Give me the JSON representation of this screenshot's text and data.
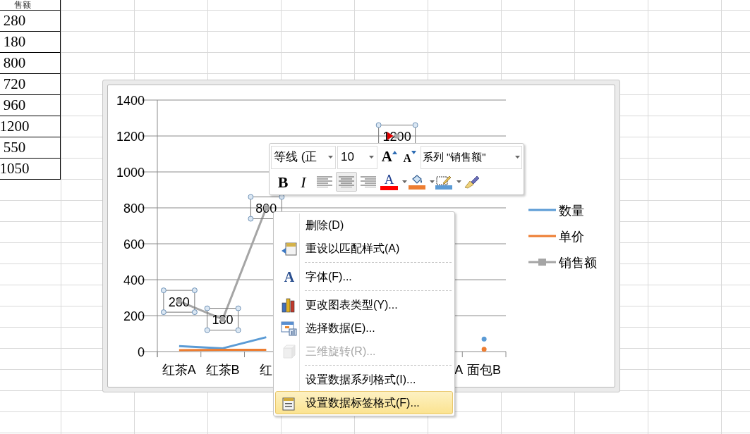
{
  "sheet": {
    "header": "售额",
    "cells": [
      "280",
      "180",
      "800",
      "720",
      "960",
      "1200",
      "550",
      "1050"
    ]
  },
  "chart": {
    "cut_axis_label": "A",
    "chart_data": {
      "type": "line",
      "categories": [
        "红茶A",
        "红茶B",
        "红",
        null,
        null,
        null,
        null,
        "面包B"
      ],
      "ylim": [
        0,
        1400
      ],
      "yticks": [
        0,
        200,
        400,
        600,
        800,
        1000,
        1200,
        1400
      ],
      "grid": true,
      "legend": "right",
      "series": [
        {
          "name": "数量",
          "color": "#5b9bd5",
          "values": [
            30,
            18,
            80,
            null,
            null,
            null,
            null,
            70
          ]
        },
        {
          "name": "单价",
          "color": "#ed7d31",
          "values": [
            8,
            10,
            10,
            null,
            null,
            null,
            null,
            13
          ]
        },
        {
          "name": "销售额",
          "color": "#a5a5a5",
          "marker": "square",
          "values": [
            280,
            180,
            800,
            null,
            null,
            1200,
            null,
            null
          ]
        }
      ],
      "value_labels": [
        "280",
        "180",
        "800",
        null,
        null,
        "1200",
        null,
        null
      ]
    }
  },
  "mini_toolbar": {
    "font": "等线 (正",
    "size": "10",
    "grow": "A",
    "shrink": "A",
    "element": "系列 \"销售额\"",
    "buttons": [
      {
        "kind": "bold",
        "label": "B",
        "selected": false
      },
      {
        "kind": "italic",
        "label": "I",
        "selected": false
      },
      {
        "kind": "align_left",
        "selected": false
      },
      {
        "kind": "align_center",
        "selected": true
      },
      {
        "kind": "align_right",
        "selected": false
      },
      {
        "kind": "font_color",
        "label": "A",
        "color": "#ff0000"
      },
      {
        "kind": "fill",
        "color": "#ed7d31"
      },
      {
        "kind": "outline",
        "color": "#5b9bd5"
      },
      {
        "kind": "painter"
      }
    ]
  },
  "context_menu": [
    {
      "kind": "item",
      "label": "删除(D)",
      "disabled": false,
      "selected": false
    },
    {
      "kind": "item",
      "label": "重设以匹配样式(A)",
      "disabled": false,
      "selected": false
    },
    {
      "kind": "separator"
    },
    {
      "kind": "item",
      "icon_text": "A",
      "label": "字体(F)...",
      "disabled": false,
      "selected": false
    },
    {
      "kind": "separator"
    },
    {
      "kind": "item",
      "label": "更改图表类型(Y)...",
      "disabled": false,
      "selected": false
    },
    {
      "kind": "item",
      "label": "选择数据(E)...",
      "disabled": false,
      "selected": false
    },
    {
      "kind": "item",
      "label": "三维旋转(R)...",
      "disabled": true,
      "selected": false
    },
    {
      "kind": "separator"
    },
    {
      "kind": "item",
      "label": "设置数据系列格式(I)...",
      "disabled": false,
      "selected": false
    },
    {
      "kind": "item",
      "label": "设置数据标签格式(F)...",
      "disabled": false,
      "selected": true
    }
  ]
}
